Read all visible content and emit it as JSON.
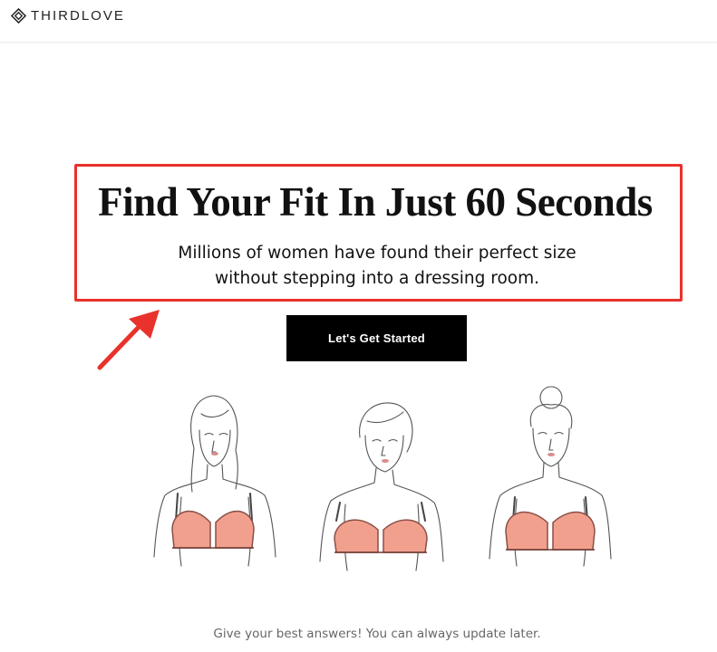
{
  "header": {
    "brand": "THIRDLOVE",
    "logo_icon": "diamond-logo-icon"
  },
  "hero": {
    "title": "Find Your Fit In Just 60 Seconds",
    "subtitle_line1": "Millions of women have found their perfect size",
    "subtitle_line2": "without stepping into a dressing room.",
    "highlight_color": "#e8322b"
  },
  "cta": {
    "label": "Let's Get Started"
  },
  "illustrations": [
    {
      "name": "woman-illustration-long-hair"
    },
    {
      "name": "woman-illustration-tilted-head"
    },
    {
      "name": "woman-illustration-bun"
    }
  ],
  "footer": {
    "note": "Give your best answers! You can always update later."
  },
  "colors": {
    "accent": "#e8322b",
    "bra": "#f2a08e",
    "cta_bg": "#000000"
  }
}
